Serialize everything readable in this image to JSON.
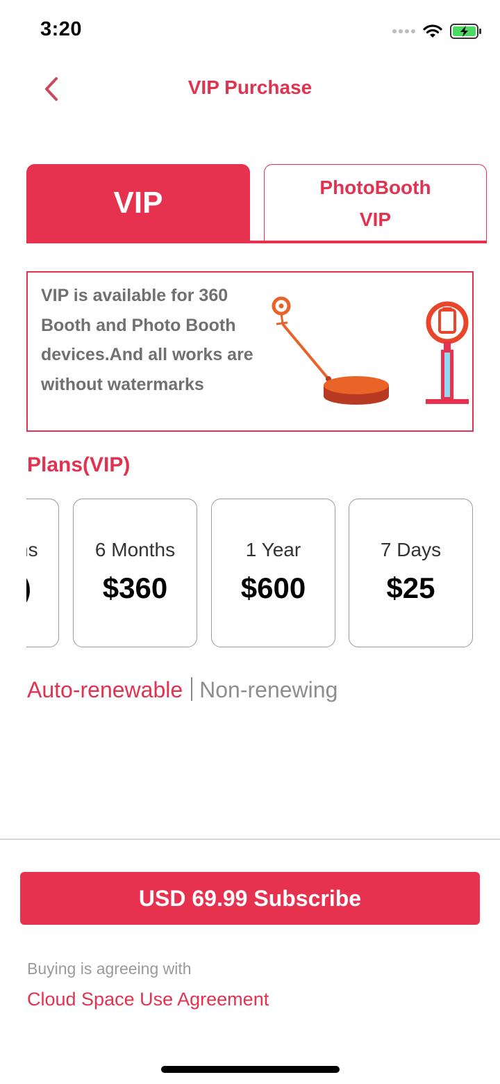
{
  "status_bar": {
    "time": "3:20"
  },
  "nav": {
    "title": "VIP Purchase",
    "back_icon": "chevron-left-icon"
  },
  "tabs": [
    {
      "label": "VIP",
      "active": true
    },
    {
      "label": "PhotoBooth VIP",
      "line1": "PhotoBooth",
      "line2": "VIP",
      "active": false
    }
  ],
  "info": {
    "text": "VIP is available for 360 Booth and Photo Booth devices.And all works are without watermarks",
    "illustration_icons": [
      "360-booth-icon",
      "photo-booth-icon"
    ]
  },
  "plans": {
    "title": "Plans(VIP)",
    "items": [
      {
        "name": "ns",
        "price": ")",
        "partial": true
      },
      {
        "name": "6 Months",
        "price": "$360"
      },
      {
        "name": "1 Year",
        "price": "$600"
      },
      {
        "name": "7 Days",
        "price": "$25"
      }
    ]
  },
  "renewal": {
    "auto": "Auto-renewable",
    "non": "Non-renewing",
    "selected": "auto"
  },
  "subscribe": {
    "label": "USD 69.99 Subscribe"
  },
  "agreement": {
    "text": "Buying is agreeing with",
    "link": "Cloud Space Use Agreement"
  },
  "colors": {
    "accent": "#e6324f",
    "text_gray": "#707070",
    "muted": "#9a9a9a"
  }
}
